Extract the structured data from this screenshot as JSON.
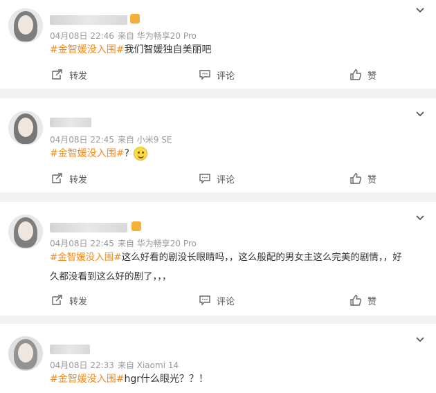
{
  "posts": [
    {
      "timestamp": "04月08日 22:46",
      "source": "来自 华为畅享20 Pro",
      "tag": "#金智媛没入围#",
      "text": "我们智媛独自美丽吧",
      "repost_label": "转发",
      "comment_label": "评论",
      "like_label": "赞"
    },
    {
      "timestamp": "04月08日 22:45",
      "source": "来自 小米9 SE",
      "tag": "#金智媛没入围#",
      "text": "?",
      "emoji": "smile-emoji",
      "repost_label": "转发",
      "comment_label": "评论",
      "like_label": "赞"
    },
    {
      "timestamp": "04月08日 22:45",
      "source": "来自 华为畅享20 Pro",
      "tag": "#金智媛没入围#",
      "text_line1": "这么好看的剧没长眼睛吗，，这么般配的男女主这么完美的剧情，，好",
      "text_line2": "久都没看到这么好的剧了，，，",
      "repost_label": "转发",
      "comment_label": "评论",
      "like_label": "赞"
    },
    {
      "timestamp": "04月08日 22:33",
      "source": "来自 Xiaomi 14",
      "tag": "#金智媛没入围#",
      "text": "hgr什么眼光？？！"
    }
  ],
  "colors": {
    "tag": "#f28a1c",
    "meta": "#999999",
    "badge": "#f4b13a"
  },
  "icons": [
    "chevron-down-icon",
    "repost-icon",
    "comment-icon",
    "like-icon"
  ]
}
